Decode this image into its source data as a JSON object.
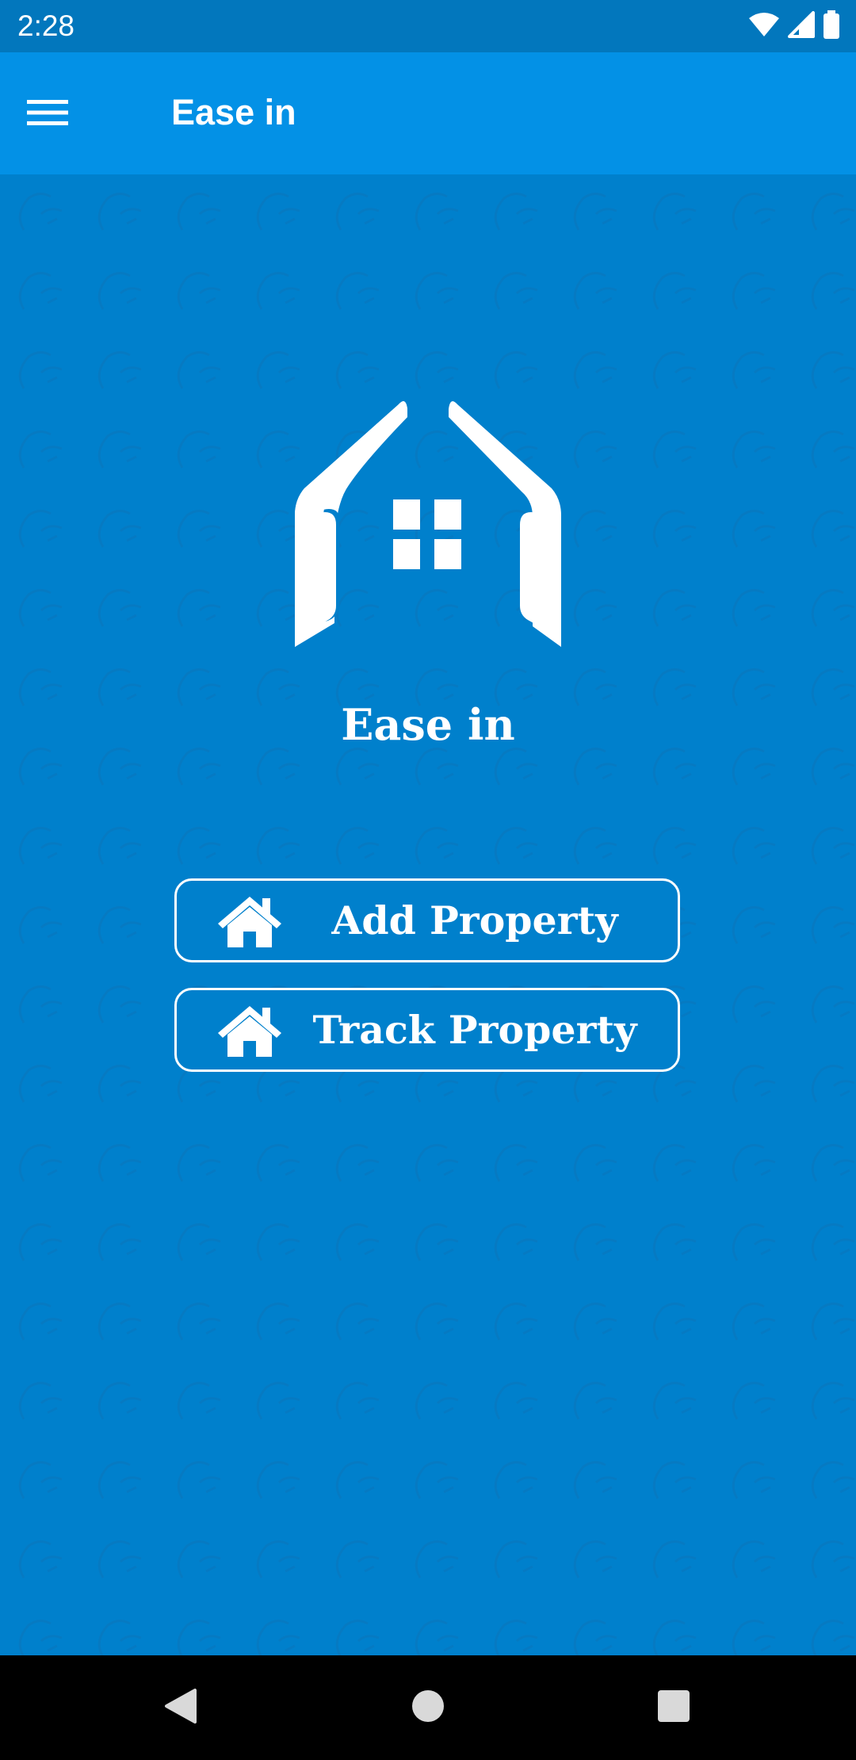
{
  "status_bar": {
    "time": "2:28",
    "icons": [
      "wifi-icon",
      "signal-icon",
      "battery-icon"
    ]
  },
  "app_bar": {
    "title": "Ease in",
    "menu_icon": "hamburger-menu-icon"
  },
  "main": {
    "logo_icon": "house-logo-icon",
    "brand_title": "Ease in",
    "buttons": [
      {
        "label": "Add Property",
        "icon": "house-icon"
      },
      {
        "label": "Track Property",
        "icon": "house-icon"
      }
    ]
  },
  "nav_bar": {
    "icons": [
      "back-icon",
      "home-icon",
      "recents-icon"
    ]
  },
  "colors": {
    "status_bar": "#0277bd",
    "app_bar": "#0391e6",
    "background": "#0080cc",
    "accent": "#ffffff",
    "nav_bar": "#000000"
  }
}
